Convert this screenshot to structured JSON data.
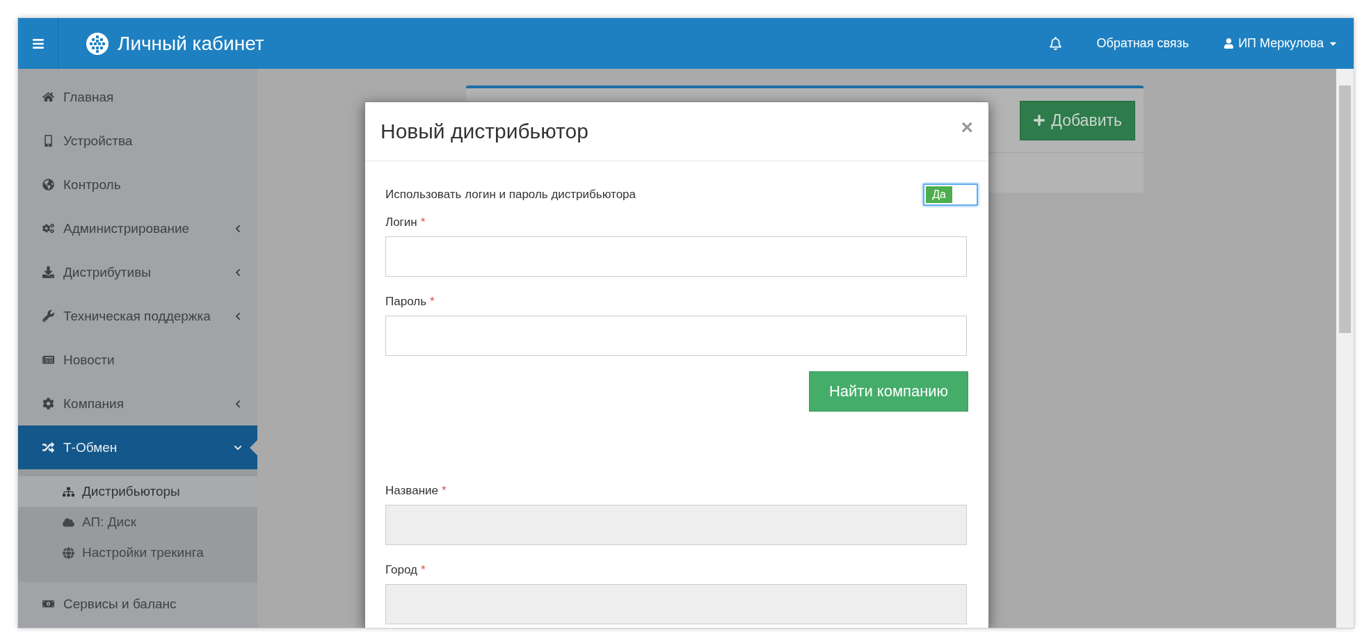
{
  "header": {
    "title": "Личный кабинет",
    "feedback": "Обратная связь",
    "user": "ИП Меркулова"
  },
  "sidebar": {
    "items": [
      {
        "label": "Главная",
        "selected": false
      },
      {
        "label": "Устройства",
        "selected": false
      },
      {
        "label": "Контроль",
        "selected": false
      },
      {
        "label": "Администрирование",
        "selected": false,
        "expanded": false
      },
      {
        "label": "Дистрибутивы",
        "selected": false,
        "expanded": false
      },
      {
        "label": "Техническая поддержка",
        "selected": false,
        "expanded": false
      },
      {
        "label": "Новости",
        "selected": false
      },
      {
        "label": "Компания",
        "selected": false,
        "expanded": false
      },
      {
        "label": "Т-Обмен",
        "selected": true,
        "expanded": true,
        "children": [
          {
            "label": "Дистрибьюторы",
            "selected": true
          },
          {
            "label": "АП: Диск",
            "selected": false
          },
          {
            "label": "Настройки трекинга",
            "selected": false
          }
        ]
      },
      {
        "label": "Сервисы и баланс",
        "selected": false
      }
    ]
  },
  "card": {
    "button": "Добавить"
  },
  "modal": {
    "title": "Новый дистрибьютор",
    "close": "×",
    "toggle": {
      "label": "Использовать логин и пароль дистрибьютора",
      "on": true,
      "on_text": "Да"
    },
    "fields": [
      {
        "label": "Логин",
        "mark": "*",
        "disabled": false
      },
      {
        "label": "Пароль",
        "mark": "*",
        "disabled": false
      }
    ],
    "button": "Найти компанию",
    "company_fields": [
      {
        "label": "Название",
        "mark": "*",
        "disabled": true
      },
      {
        "label": "Город",
        "mark": "*",
        "disabled": true
      }
    ]
  }
}
